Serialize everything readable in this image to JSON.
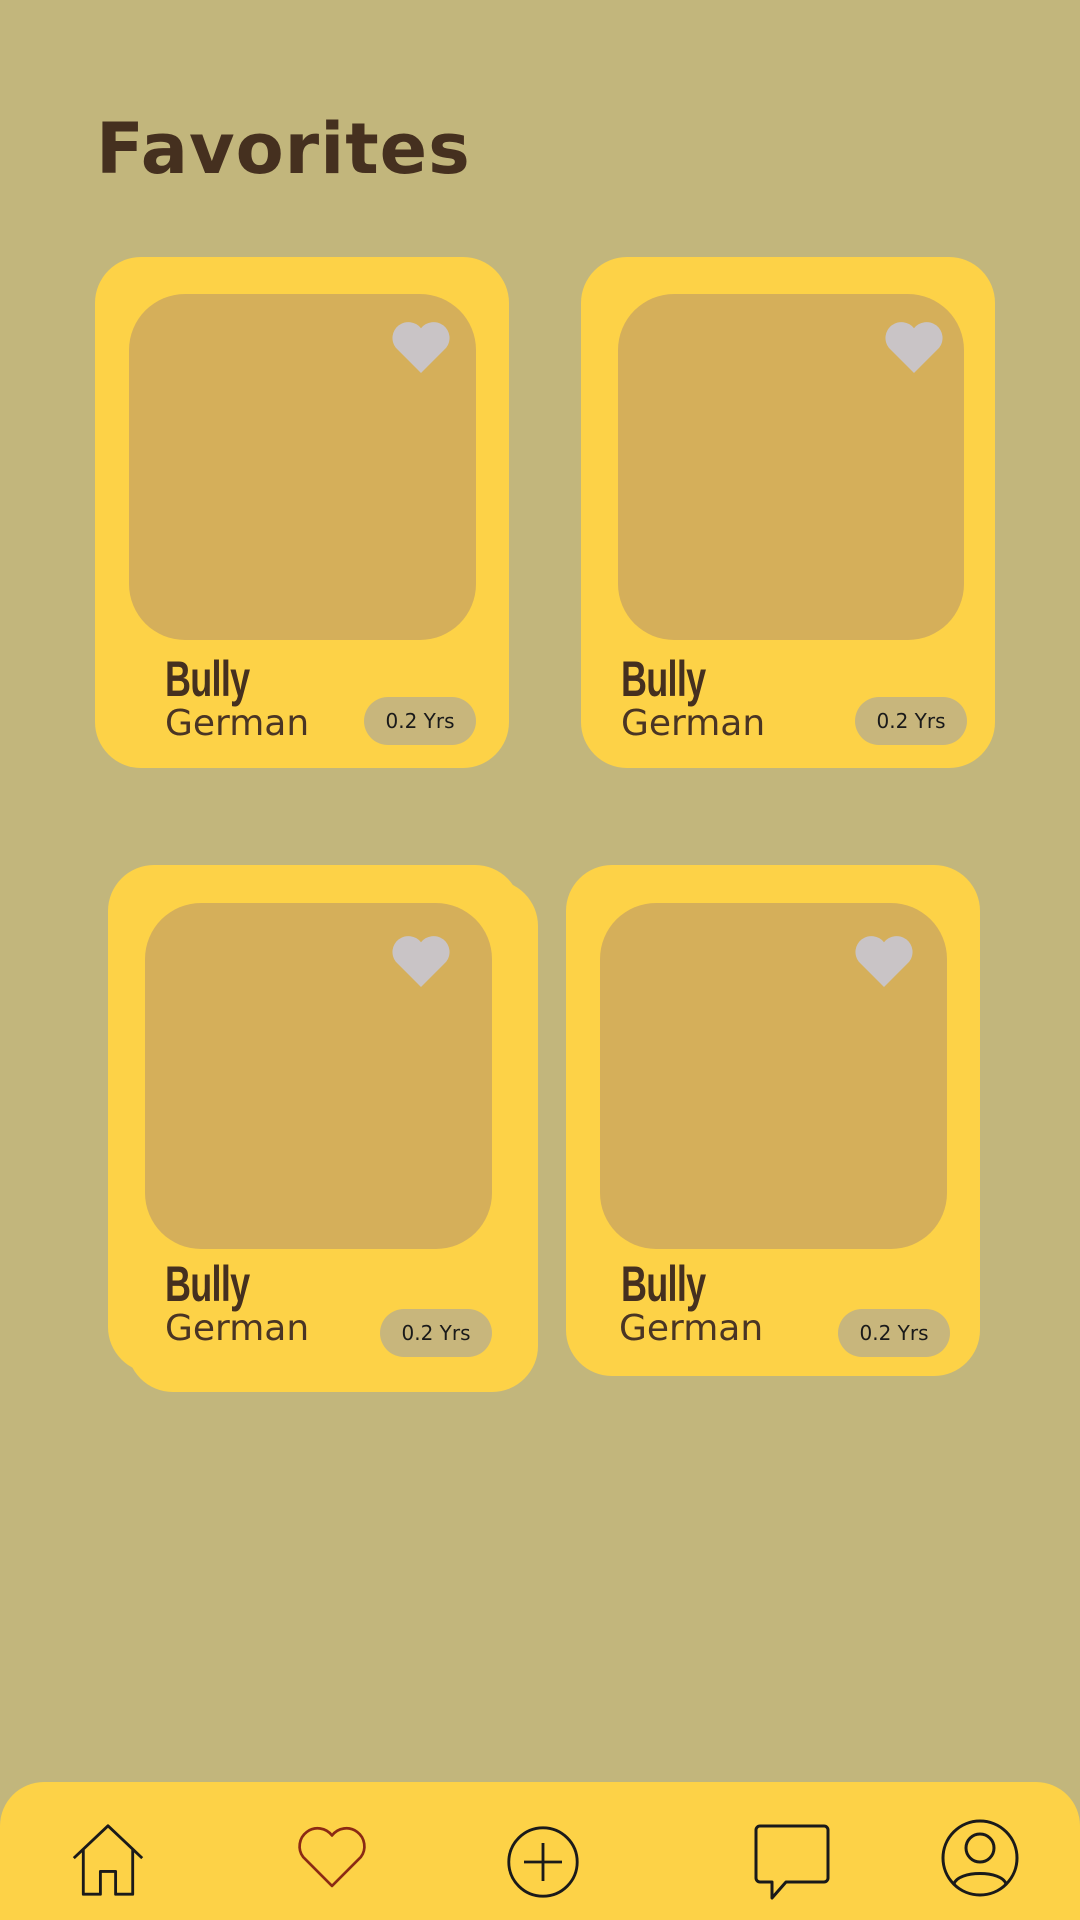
{
  "header": {
    "title": "Favorites"
  },
  "cards": [
    {
      "name": "Bully",
      "breed": "German",
      "age": "0.2 Yrs"
    },
    {
      "name": "Bully",
      "breed": "German",
      "age": "0.2 Yrs"
    },
    {
      "name": "Bully",
      "breed": "German",
      "age": "0.2 Yrs"
    },
    {
      "name": "Bully",
      "breed": "German",
      "age": "0.2 Yrs"
    }
  ],
  "nav": {
    "items": [
      {
        "icon": "home-icon"
      },
      {
        "icon": "heart-icon"
      },
      {
        "icon": "plus-circle-icon"
      },
      {
        "icon": "chat-icon"
      },
      {
        "icon": "profile-icon"
      }
    ]
  },
  "colors": {
    "background": "#c2b67c",
    "card": "#fdd247",
    "photo_placeholder": "#d5af5a",
    "text_dark": "#45301f",
    "heart_inactive": "#c9c4c6",
    "nav_heart_active": "#8b2a14"
  }
}
